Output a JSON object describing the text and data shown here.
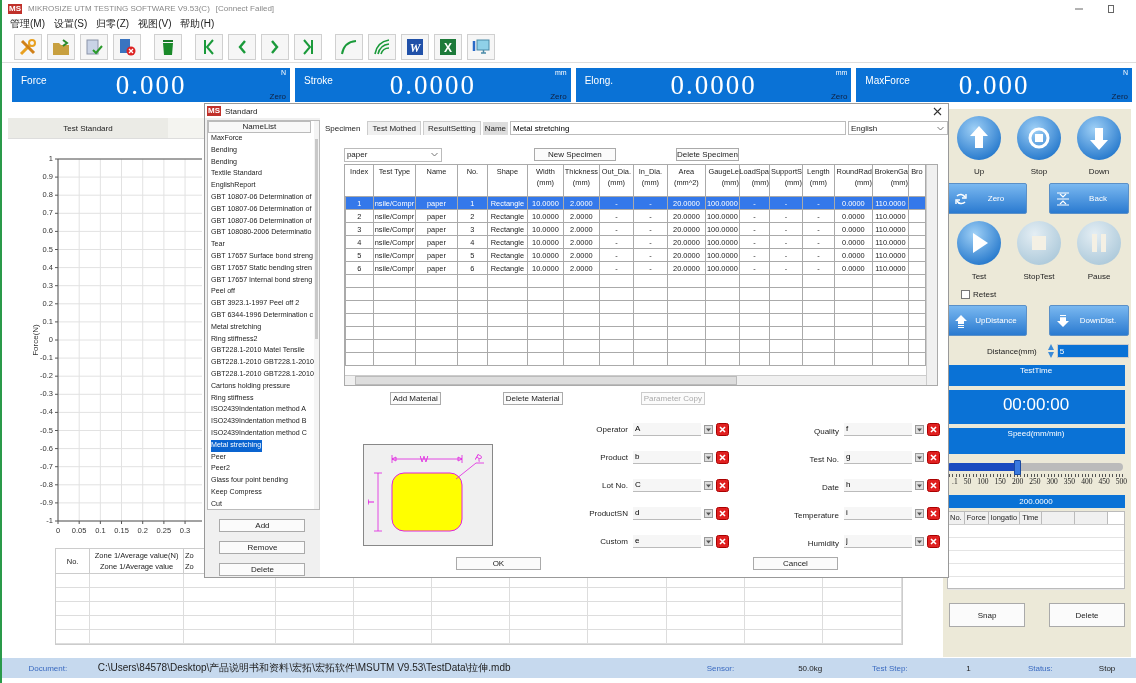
{
  "window": {
    "logo": "MS",
    "title": "MIKROSIZE UTM TESTING SOFTWARE V9.53(C)",
    "connection": "[Connect Failed]"
  },
  "menu": [
    "管理(M)",
    "设置(S)",
    "归零(Z)",
    "视图(V)",
    "帮助(H)"
  ],
  "toolbar": [
    {
      "kind": "tools"
    },
    {
      "kind": "folder"
    },
    {
      "kind": "doc-check"
    },
    {
      "kind": "doc-delete"
    },
    {
      "kind": "trash"
    },
    {
      "kind": "first"
    },
    {
      "kind": "prev"
    },
    {
      "kind": "next"
    },
    {
      "kind": "last"
    },
    {
      "kind": "curve"
    },
    {
      "kind": "curves"
    },
    {
      "kind": "word",
      "label": "W"
    },
    {
      "kind": "excel",
      "label": "X"
    },
    {
      "kind": "monitor"
    }
  ],
  "readouts": [
    {
      "label": "Force",
      "value": "0.000",
      "unit": "N",
      "zero": "Zero"
    },
    {
      "label": "Stroke",
      "value": "0.0000",
      "unit": "mm",
      "zero": "Zero"
    },
    {
      "label": "Elong.",
      "value": "0.0000",
      "unit": "mm",
      "zero": "Zero"
    },
    {
      "label": "MaxForce",
      "value": "0.000",
      "unit": "N",
      "zero": "Zero"
    }
  ],
  "standard_tab": "Test Standard",
  "chart": {
    "chart_data": {
      "type": "line",
      "ylabel": "Force(N)",
      "xlim": [
        0,
        0.34
      ],
      "ylim": [
        -1,
        1
      ],
      "grid": true,
      "xticks": [
        0,
        0.05,
        0.1,
        0.15,
        0.2,
        0.25,
        0.3
      ],
      "yticks": [
        1,
        0.9,
        0.8,
        0.7,
        0.6,
        0.5,
        0.4,
        0.3,
        0.2,
        0.1,
        0,
        -0.1,
        -0.2,
        -0.3,
        -0.4,
        -0.5,
        -0.6,
        -0.7,
        -0.8,
        -0.9,
        -1
      ]
    }
  },
  "results_table": {
    "columns": [
      {
        "label": "No."
      },
      {
        "label": "Zone 1/Average value(N)",
        "sublabel": "Zone 1/Average value"
      },
      {
        "label": "Zo",
        "sublabel": "Zo"
      }
    ]
  },
  "control_panel": {
    "jog_buttons": [
      {
        "kind": "up",
        "label": "Up"
      },
      {
        "kind": "stop",
        "label": "Stop"
      },
      {
        "kind": "down",
        "label": "Down"
      }
    ],
    "position_buttons": [
      {
        "kind": "zero",
        "label": "Zero"
      },
      {
        "kind": "back",
        "label": "Back"
      }
    ],
    "test_buttons": [
      {
        "kind": "play",
        "label": "Test",
        "disabled": false
      },
      {
        "kind": "square",
        "label": "StopTest",
        "disabled": true
      },
      {
        "kind": "pause",
        "label": "Pause",
        "disabled": true
      }
    ],
    "retest": {
      "label": "Retest",
      "checked": false
    },
    "distance_buttons": [
      {
        "kind": "up",
        "label": "UpDistance"
      },
      {
        "kind": "down",
        "label": "DownDist."
      }
    ],
    "distance": {
      "label": "Distance(mm)",
      "value": "5"
    },
    "test_time_label": "TestTime",
    "test_time": "00:00:00",
    "speed_label": "Speed(mm/min)",
    "speed_slider": {
      "level": 0.4,
      "ticks": [
        ".1",
        "50",
        "100",
        "150",
        "200",
        "250",
        "300",
        "350",
        "400",
        "450",
        "500"
      ]
    },
    "speed_value": "200.0000",
    "log_columns": [
      "No.",
      "Force",
      "longatio",
      "Time"
    ],
    "buttons": [
      "Snap",
      "Delete"
    ]
  },
  "status_bar": [
    {
      "label": "Document:",
      "value": "C:\\Users\\84578\\Desktop\\产品说明书和资料\\宏拓\\宏拓软件\\MSUTM V9.53\\TestData\\拉伸.mdb"
    },
    {
      "label": "Sensor:",
      "value": "50.0kg"
    },
    {
      "label": "Test Step:",
      "value": "1"
    },
    {
      "label": "Status:",
      "value": "Stop"
    }
  ],
  "dialog": {
    "logo": "MS",
    "title": "Standard",
    "list_header": "NameList",
    "items": [
      {
        "label": "MaxForce",
        "selected": false
      },
      {
        "label": "Bending",
        "selected": false
      },
      {
        "label": "Bending",
        "selected": false
      },
      {
        "label": "Textile Standard",
        "selected": false
      },
      {
        "label": "EnglishReport",
        "selected": false
      },
      {
        "label": "GBT 10807-06 Determination of",
        "selected": false
      },
      {
        "label": "GBT 10807-06 Determination of",
        "selected": false
      },
      {
        "label": "GBT 10807-06 Determination of",
        "selected": false
      },
      {
        "label": "GBT 108080-2006 Determinatio",
        "selected": false
      },
      {
        "label": "Tear",
        "selected": false
      },
      {
        "label": "GBT 17657 Surface bond streng",
        "selected": false
      },
      {
        "label": "GBT 17657 Static bending stren",
        "selected": false
      },
      {
        "label": "GBT 17657 Internal bond streng",
        "selected": false
      },
      {
        "label": "Peel off",
        "selected": false
      },
      {
        "label": "GBT 3923.1-1997 Peel off 2",
        "selected": false
      },
      {
        "label": "GBT 6344-1996 Determination c",
        "selected": false
      },
      {
        "label": "Metal stretching",
        "selected": false
      },
      {
        "label": "Ring stiffness2",
        "selected": false
      },
      {
        "label": "GBT228.1-2010 Matel Tensile",
        "selected": false
      },
      {
        "label": "GBT228.1-2010 GBT228.1-2010",
        "selected": false
      },
      {
        "label": "GBT228.1-2010 GBT228.1-2010",
        "selected": false
      },
      {
        "label": "Cartons holding pressure",
        "selected": false
      },
      {
        "label": "Ring stiffness",
        "selected": false
      },
      {
        "label": "ISO2439Indentation method A",
        "selected": false
      },
      {
        "label": "ISO2439Indentation method B",
        "selected": false
      },
      {
        "label": "ISO2439Indentation method C",
        "selected": false
      },
      {
        "label": "Metal stretching",
        "selected": true
      },
      {
        "label": "Peer",
        "selected": false
      },
      {
        "label": "Peer2",
        "selected": false
      },
      {
        "label": "Glass four point bending",
        "selected": false
      },
      {
        "label": "Keep Compress",
        "selected": false
      },
      {
        "label": "Cut",
        "selected": false
      }
    ],
    "list_buttons": [
      "Add",
      "Remove",
      "Delete"
    ],
    "tabs": [
      {
        "label": "Specimen",
        "selected": true
      },
      {
        "label": "Test Mothed",
        "selected": false
      },
      {
        "label": "ResultSetting",
        "selected": false
      }
    ],
    "name_label": "Name",
    "name_value": "Metal stretching",
    "language": "English",
    "specimen_select": "paper",
    "specimen_buttons": [
      "New Specimen",
      "Delete Specimen"
    ],
    "table": {
      "columns": [
        {
          "label": "Index"
        },
        {
          "label": "Test Type"
        },
        {
          "label": "Name"
        },
        {
          "label": "No."
        },
        {
          "label": "Shape"
        },
        {
          "label": "Width",
          "unit": "(mm)"
        },
        {
          "label": "Thickness",
          "unit": "(mm)"
        },
        {
          "label": "Out_Dia.",
          "unit": "(mm)"
        },
        {
          "label": "In_Dia.",
          "unit": "(mm)"
        },
        {
          "label": "Area",
          "unit": "(mm^2)"
        },
        {
          "label": "GaugeLe",
          "unit": "(mm)"
        },
        {
          "label": "LoadSpa",
          "unit": "(mm)"
        },
        {
          "label": "SupportS",
          "unit": "(mm)"
        },
        {
          "label": "Length",
          "unit": "(mm)"
        },
        {
          "label": "RoundRad",
          "unit": "(mm)"
        },
        {
          "label": "BrokenGa",
          "unit": "(mm)"
        },
        {
          "label": "Bro"
        }
      ],
      "rows": [
        {
          "selected": true,
          "cells": [
            "1",
            "nsile/Compr",
            "paper",
            "1",
            "Rectangle",
            "10.0000",
            "2.0000",
            "-",
            "-",
            "20.0000",
            "100.0000",
            "-",
            "-",
            "-",
            "0.0000",
            "110.0000"
          ]
        },
        {
          "selected": false,
          "cells": [
            "2",
            "nsile/Compr",
            "paper",
            "2",
            "Rectangle",
            "10.0000",
            "2.0000",
            "-",
            "-",
            "20.0000",
            "100.0000",
            "-",
            "-",
            "-",
            "0.0000",
            "110.0000"
          ]
        },
        {
          "selected": false,
          "cells": [
            "3",
            "nsile/Compr",
            "paper",
            "3",
            "Rectangle",
            "10.0000",
            "2.0000",
            "-",
            "-",
            "20.0000",
            "100.0000",
            "-",
            "-",
            "-",
            "0.0000",
            "110.0000"
          ]
        },
        {
          "selected": false,
          "cells": [
            "4",
            "nsile/Compr",
            "paper",
            "4",
            "Rectangle",
            "10.0000",
            "2.0000",
            "-",
            "-",
            "20.0000",
            "100.0000",
            "-",
            "-",
            "-",
            "0.0000",
            "110.0000"
          ]
        },
        {
          "selected": false,
          "cells": [
            "5",
            "nsile/Compr",
            "paper",
            "5",
            "Rectangle",
            "10.0000",
            "2.0000",
            "-",
            "-",
            "20.0000",
            "100.0000",
            "-",
            "-",
            "-",
            "0.0000",
            "110.0000"
          ]
        },
        {
          "selected": false,
          "cells": [
            "6",
            "nsile/Compr",
            "paper",
            "6",
            "Rectangle",
            "10.0000",
            "2.0000",
            "-",
            "-",
            "20.0000",
            "100.0000",
            "-",
            "-",
            "-",
            "0.0000",
            "110.0000"
          ]
        }
      ]
    },
    "material_buttons": [
      {
        "label": "Add Material",
        "disabled": false
      },
      {
        "label": "Delete  Material",
        "disabled": false
      },
      {
        "label": "Parameter Copy",
        "disabled": true
      }
    ],
    "shape_labels": {
      "width": "W",
      "thickness": "T",
      "radius": "R"
    },
    "fields_left": [
      {
        "label": "Operator",
        "value": "A"
      },
      {
        "label": "Product",
        "value": "b"
      },
      {
        "label": "Lot No.",
        "value": "C"
      },
      {
        "label": "ProductSN",
        "value": "d"
      },
      {
        "label": "Custom",
        "value": "e"
      }
    ],
    "fields_right": [
      {
        "label": "Quality",
        "value": "f"
      },
      {
        "label": "Test No.",
        "value": "g"
      },
      {
        "label": "Date",
        "value": "h"
      },
      {
        "label": "Temperature",
        "value": "i"
      },
      {
        "label": "Humidity",
        "value": "j"
      }
    ],
    "ok": "OK",
    "cancel": "Cancel"
  }
}
